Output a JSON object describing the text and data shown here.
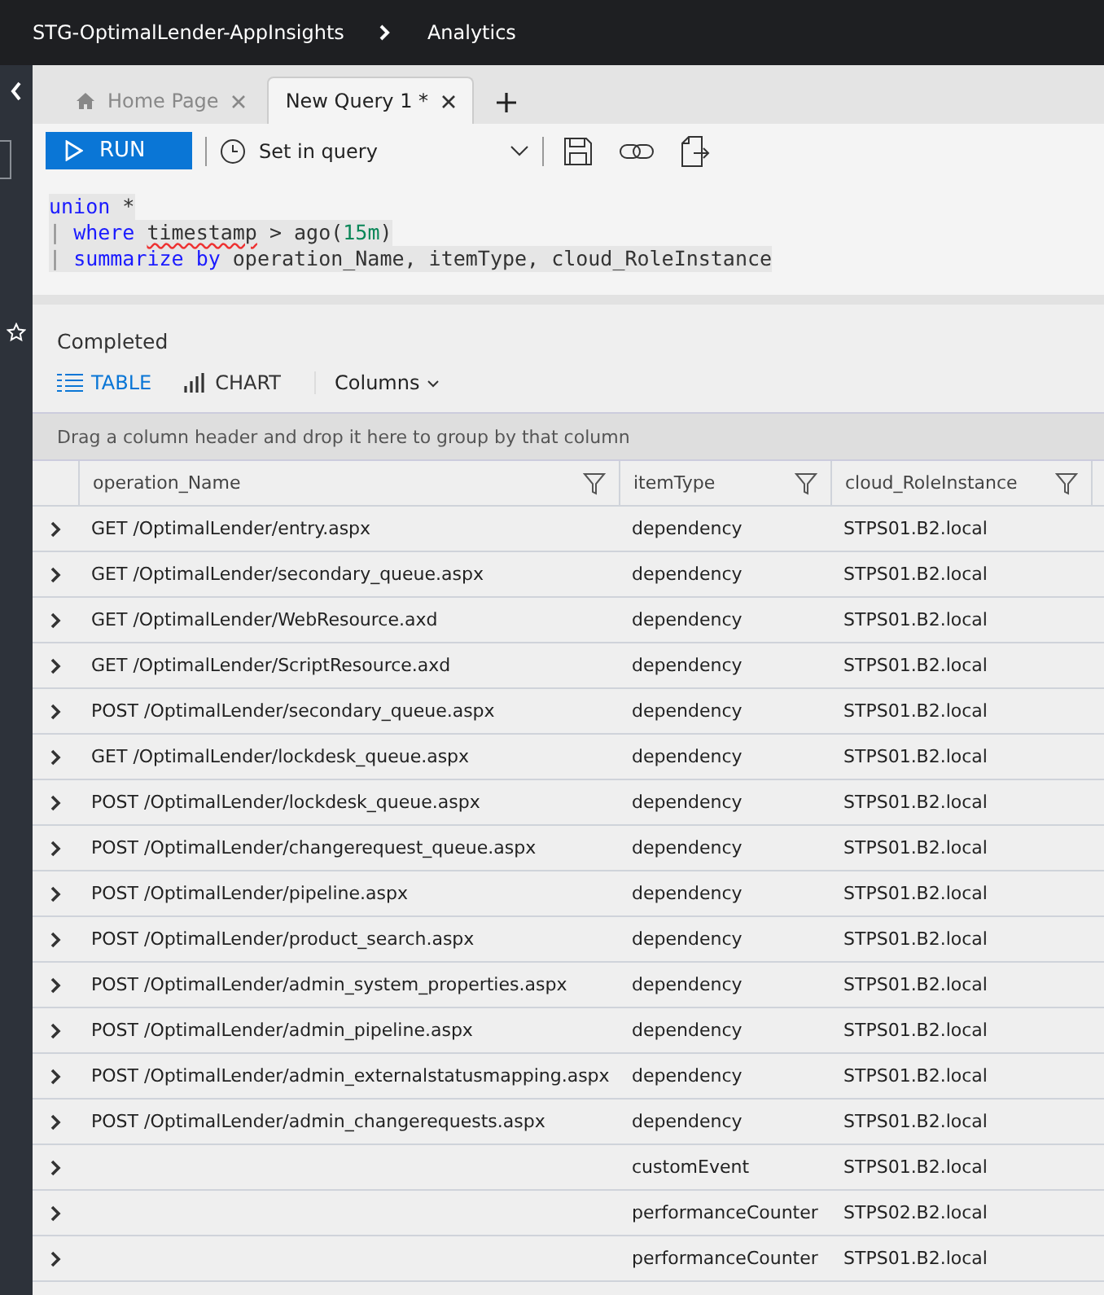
{
  "breadcrumb": [
    "STG-OptimalLender-AppInsights",
    "Analytics"
  ],
  "tabs": [
    {
      "label": "Home Page",
      "selected": false,
      "kind": "home"
    },
    {
      "label": "New Query 1 *",
      "selected": true,
      "kind": "query"
    }
  ],
  "toolbar": {
    "run": "RUN",
    "time_range": "Set in query"
  },
  "query": [
    [
      {
        "kind": "keyword",
        "text": "union"
      },
      {
        "kind": "plain",
        "text": " *"
      }
    ],
    [
      {
        "kind": "pipe",
        "text": "| "
      },
      {
        "kind": "keyword",
        "text": "where "
      },
      {
        "kind": "squiggle",
        "text": "timestamp"
      },
      {
        "kind": "plain",
        "text": " > ago("
      },
      {
        "kind": "number",
        "text": "15m"
      },
      {
        "kind": "plain",
        "text": ")"
      }
    ],
    [
      {
        "kind": "pipe",
        "text": "| "
      },
      {
        "kind": "keyword",
        "text": "summarize by"
      },
      {
        "kind": "plain",
        "text": " operation_Name, itemType, cloud_RoleInstance"
      }
    ]
  ],
  "status": "Completed",
  "views": [
    {
      "label": "TABLE",
      "selected": true,
      "kind": "table"
    },
    {
      "label": "CHART",
      "selected": false,
      "kind": "chart"
    }
  ],
  "columns_menu": "Columns",
  "group_hint": "Drag a column header and drop it here to group by that column",
  "table": {
    "columns": [
      "operation_Name",
      "itemType",
      "cloud_RoleInstance"
    ],
    "rows": [
      [
        "GET /OptimalLender/entry.aspx",
        "dependency",
        "STPS01.B2.local"
      ],
      [
        "GET /OptimalLender/secondary_queue.aspx",
        "dependency",
        "STPS01.B2.local"
      ],
      [
        "GET /OptimalLender/WebResource.axd",
        "dependency",
        "STPS01.B2.local"
      ],
      [
        "GET /OptimalLender/ScriptResource.axd",
        "dependency",
        "STPS01.B2.local"
      ],
      [
        "POST /OptimalLender/secondary_queue.aspx",
        "dependency",
        "STPS01.B2.local"
      ],
      [
        "GET /OptimalLender/lockdesk_queue.aspx",
        "dependency",
        "STPS01.B2.local"
      ],
      [
        "POST /OptimalLender/lockdesk_queue.aspx",
        "dependency",
        "STPS01.B2.local"
      ],
      [
        "POST /OptimalLender/changerequest_queue.aspx",
        "dependency",
        "STPS01.B2.local"
      ],
      [
        "POST /OptimalLender/pipeline.aspx",
        "dependency",
        "STPS01.B2.local"
      ],
      [
        "POST /OptimalLender/product_search.aspx",
        "dependency",
        "STPS01.B2.local"
      ],
      [
        "POST /OptimalLender/admin_system_properties.aspx",
        "dependency",
        "STPS01.B2.local"
      ],
      [
        "POST /OptimalLender/admin_pipeline.aspx",
        "dependency",
        "STPS01.B2.local"
      ],
      [
        "POST /OptimalLender/admin_externalstatusmapping.aspx",
        "dependency",
        "STPS01.B2.local"
      ],
      [
        "POST /OptimalLender/admin_changerequests.aspx",
        "dependency",
        "STPS01.B2.local"
      ],
      [
        "",
        "customEvent",
        "STPS01.B2.local"
      ],
      [
        "",
        "performanceCounter",
        "STPS02.B2.local"
      ],
      [
        "",
        "performanceCounter",
        "STPS01.B2.local"
      ]
    ]
  }
}
